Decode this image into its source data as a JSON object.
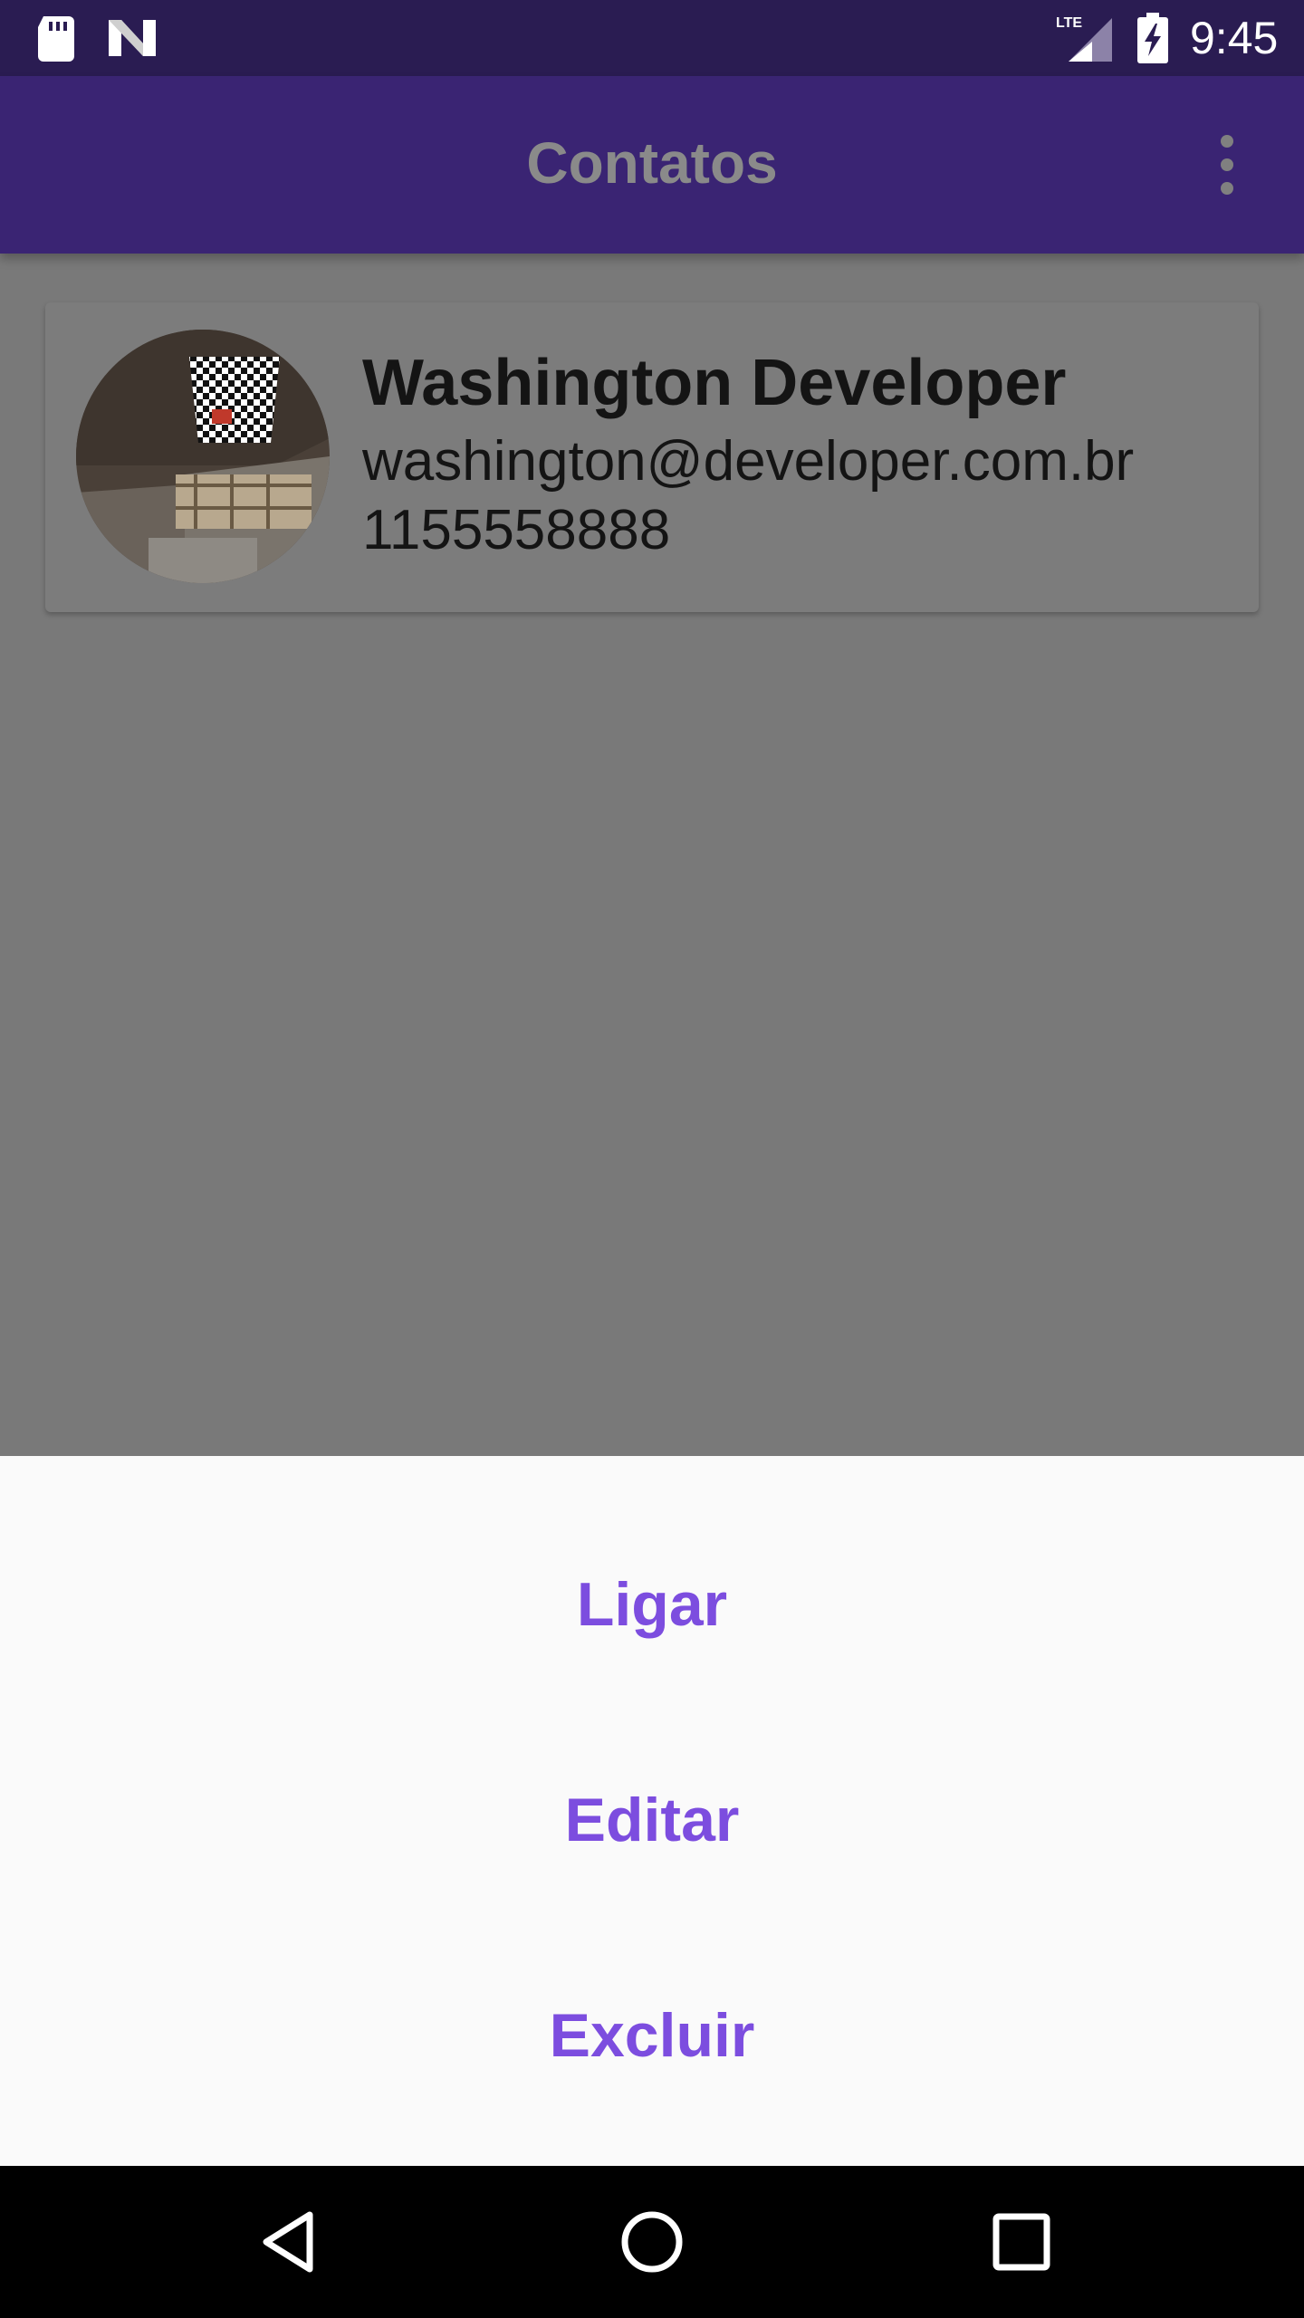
{
  "status_bar": {
    "time": "9:45",
    "network": "LTE",
    "icons": [
      "sd-card-icon",
      "n-notification-icon",
      "lte-signal-icon",
      "battery-charging-icon"
    ]
  },
  "app_bar": {
    "title": "Contatos",
    "overflow_icon": "more-vert-icon"
  },
  "contact": {
    "name": "Washington Developer",
    "email": "washington@developer.com.br",
    "phone": "1155558888",
    "avatar_icon": "contact-photo"
  },
  "bottom_sheet": {
    "actions": [
      {
        "label": "Ligar"
      },
      {
        "label": "Editar"
      },
      {
        "label": "Excluir"
      }
    ]
  },
  "nav_bar": {
    "icons": [
      "back-icon",
      "home-icon",
      "recents-icon"
    ]
  },
  "colors": {
    "status_bar": "#2a1c52",
    "app_bar": "#3a2473",
    "scrim_background": "#797979",
    "sheet_background": "#fafafa",
    "action_text": "#7c4ddf"
  }
}
